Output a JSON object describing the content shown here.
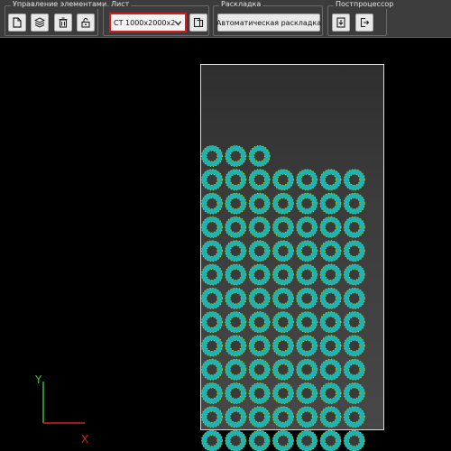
{
  "toolbar": {
    "elements_group": {
      "title": "Управление элементами",
      "buttons": [
        {
          "name": "new-document-button",
          "icon": "document-icon"
        },
        {
          "name": "layers-button",
          "icon": "layers-icon"
        },
        {
          "name": "delete-button",
          "icon": "trash-icon"
        },
        {
          "name": "unlock-button",
          "icon": "unlock-icon"
        }
      ]
    },
    "sheet_group": {
      "title": "Лист",
      "selected_sheet": "СТ 1000x2000x2",
      "button_icon": "sheet-copy-icon"
    },
    "layout_group": {
      "title": "Раскладка",
      "button_label": "Автоматическая раскладка"
    },
    "postprocessor_group": {
      "title": "Постпроцессор",
      "buttons": [
        {
          "name": "export-button",
          "icon": "download-icon"
        },
        {
          "name": "exit-button",
          "icon": "logout-icon"
        }
      ]
    }
  },
  "canvas": {
    "axis": {
      "x_label": "X",
      "y_label": "Y",
      "x_color": "#d81f1f",
      "y_color": "#3fbf3f"
    },
    "sheet": {
      "border_color": "#d8d8d8"
    },
    "nesting": {
      "part_color": "#1bb3b3",
      "dot_color": "#c8d400",
      "top_row_count": 3,
      "full_row_count": 7,
      "full_rows": 12
    }
  }
}
